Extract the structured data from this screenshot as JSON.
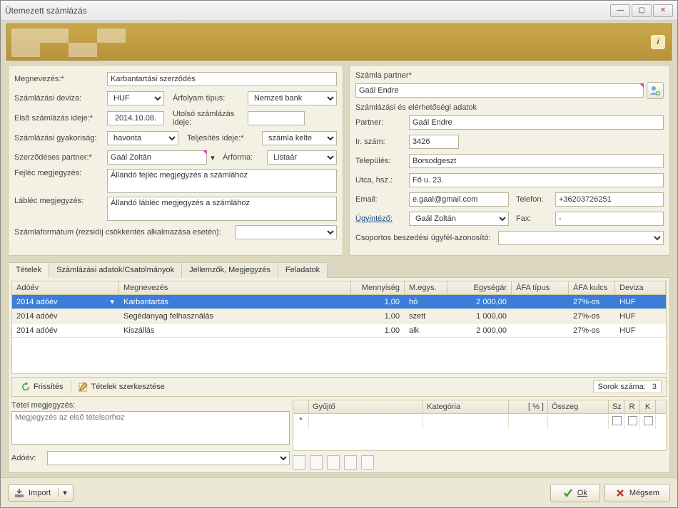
{
  "window": {
    "title": "Ütemezett számlázás"
  },
  "left": {
    "megnevezes_lbl": "Megnevezés:*",
    "megnevezes": "Karbantartási szerződés",
    "szdeviza_lbl": "Számlázási deviza:",
    "szdeviza": "HUF",
    "arfolyam_lbl": "Árfolyam típus:",
    "arfolyam": "Nemzeti bank",
    "elso_lbl": "Első számlázás ideje:*",
    "elso": "2014.10.08.",
    "utolso_lbl": "Utolsó számlázás ideje:",
    "utolso": "",
    "gyak_lbl": "Számlázási gyakoriság:",
    "gyak": "havonta",
    "telj_lbl": "Teljesítés ideje:*",
    "telj": "számla kelte",
    "szerzpartner_lbl": "Szerződéses partner:*",
    "szerzpartner": "Gaál Zoltán",
    "arforma_lbl": "Árforma:",
    "arforma": "Listaár",
    "fejlec_lbl": "Fejléc megjegyzés:",
    "fejlec": "Állandó fejléc megjegyzés a számlához",
    "lablec_lbl": "Lábléc megjegyzés:",
    "lablec": "Állandó lábléc megjegyzés a számlához",
    "format_lbl": "Számlaformátum (rezsidíj csökkentés alkalmazása esetén):",
    "format": ""
  },
  "right": {
    "partner_header": "Számla partner*",
    "partner_value": "Gaál Endre",
    "section_header": "Számlázási és elérhetőségi adatok",
    "partner_lbl": "Partner:",
    "partner": "Gaál Endre",
    "irszam_lbl": "Ir. szám:",
    "irszam": "3426",
    "telepules_lbl": "Település:",
    "telepules": "Borsodgeszt",
    "utca_lbl": "Utca, hsz.:",
    "utca": "Fő u. 23.",
    "email_lbl": "Email:",
    "email": "e.gaal@gmail.com",
    "telefon_lbl": "Telefon:",
    "telefon": "+36203726251",
    "ugyintezo_lbl": "Ügyintéző:",
    "ugyintezo": "Gaál Zoltán",
    "fax_lbl": "Fax:",
    "fax": "-",
    "csoportos_lbl": "Csoportos beszedési ügyfél-azonosító:",
    "csoportos": ""
  },
  "tabs": {
    "t0": "Tételek",
    "t1": "Számlázási adatok/Csatolmányok",
    "t2": "Jellemzők, Megjegyzés",
    "t3": "Feladatok"
  },
  "grid": {
    "h0": "Adóév",
    "h1": "Megnevezés",
    "h2": "Mennyiség",
    "h3": "M.egys.",
    "h4": "Egységár",
    "h5": "ÁFA típus",
    "h6": "ÁFA kulcs",
    "h7": "Deviza",
    "rows": [
      {
        "adoev": "2014 adóév",
        "megnev": "Karbantartás",
        "menny": "1,00",
        "me": "hó",
        "egys": "2 000,00",
        "afat": "",
        "afak": "27%-os",
        "dev": "HUF"
      },
      {
        "adoev": "2014 adóév",
        "megnev": "Segédanyag felhasználás",
        "menny": "1,00",
        "me": "szett",
        "egys": "1 000,00",
        "afat": "",
        "afak": "27%-os",
        "dev": "HUF"
      },
      {
        "adoev": "2014 adóév",
        "megnev": "Kiszállás",
        "menny": "1,00",
        "me": "alk",
        "egys": "2 000,00",
        "afat": "",
        "afak": "27%-os",
        "dev": "HUF"
      }
    ]
  },
  "toolbar": {
    "frissites": "Frissítés",
    "szerk": "Tételek szerkesztése",
    "count_lbl": "Sorok száma:",
    "count": "3"
  },
  "note": {
    "lbl": "Tétel megjegyzés:",
    "text": "Megjegyzés az első tételsorhoz",
    "adoev_lbl": "Adóév:"
  },
  "detail": {
    "h0": "Gyűjtő",
    "h1": "Kategória",
    "h2": "[ % ]",
    "h3": "Összeg",
    "h4": "Sz",
    "h5": "R",
    "h6": "K"
  },
  "footer": {
    "import": "Import",
    "ok": "Ok",
    "cancel": "Mégsem"
  }
}
